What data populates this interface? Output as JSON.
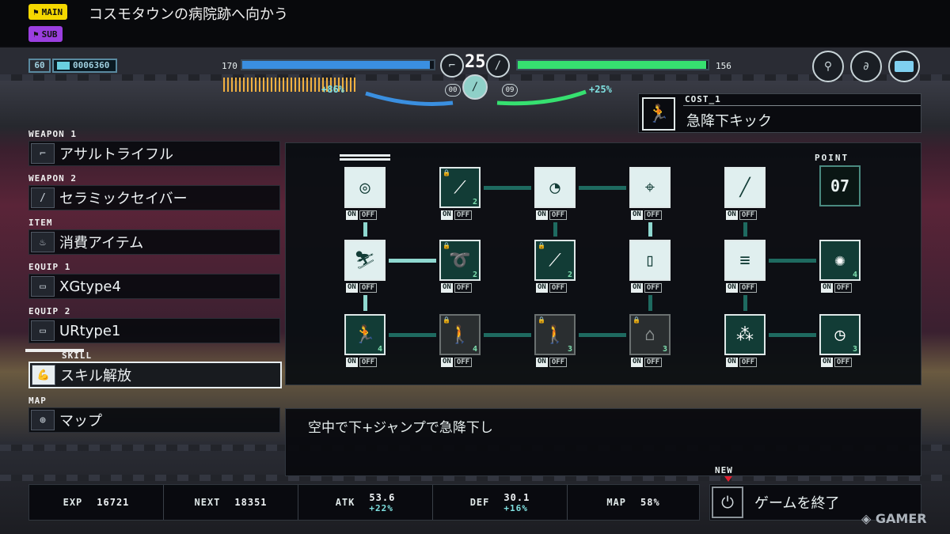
{
  "quest": {
    "main_badge": "MAIN",
    "main_text": "コスモタウンの病院跡へ向かう",
    "sub_badge": "SUB",
    "main_color": "#f5d800",
    "sub_color": "#9b3fe0"
  },
  "hud": {
    "level": "60",
    "money": "0006360",
    "hp_left": "170",
    "hp_right": "156",
    "center_value": "25",
    "left_counter": "00",
    "right_counter": "09",
    "left_bonus": "+86%",
    "right_bonus": "+25%",
    "hp_left_fraction": 0.98,
    "hp_right_fraction": 0.99,
    "colors": {
      "blue": "#3a8fe0",
      "green": "#36e070"
    }
  },
  "skill_header": {
    "cost_label": "COST_1",
    "name": "急降下キック"
  },
  "menu": {
    "weapon1": {
      "cat": "WEAPON 1",
      "label": "アサルトライフル",
      "icon": "rifle-icon"
    },
    "weapon2": {
      "cat": "WEAPON 2",
      "label": "セラミックセイバー",
      "icon": "saber-icon"
    },
    "item": {
      "cat": "ITEM",
      "label": "消費アイテム",
      "icon": "pot-icon"
    },
    "equip1": {
      "cat": "EQUIP 1",
      "label": "XGtype4",
      "icon": "chip-icon"
    },
    "equip2": {
      "cat": "EQUIP 2",
      "label": "URtype1",
      "icon": "chip-icon"
    },
    "skill": {
      "cat": "SKILL",
      "label": "スキル解放",
      "icon": "flex-arm-icon"
    },
    "map": {
      "cat": "MAP",
      "label": "マップ",
      "icon": "map-pin-icon"
    }
  },
  "skill_tree": {
    "point_label": "POINT",
    "point_value": "07",
    "on": "ON",
    "off": "OFF",
    "nodes": [
      {
        "id": "r1c1",
        "icon": "ring-icon",
        "lv": ""
      },
      {
        "id": "r1c2",
        "icon": "blade-up-icon",
        "lv": "2"
      },
      {
        "id": "r1c3",
        "icon": "slash-icon",
        "lv": ""
      },
      {
        "id": "r1c4",
        "icon": "crosshair-icon",
        "lv": ""
      },
      {
        "id": "r1c5",
        "icon": "sword-icon",
        "lv": ""
      },
      {
        "id": "r2c1",
        "icon": "slide-kick-icon",
        "lv": ""
      },
      {
        "id": "r2c2",
        "icon": "roll-icon",
        "lv": "2"
      },
      {
        "id": "r2c3",
        "icon": "blade-up-icon",
        "lv": "2"
      },
      {
        "id": "r2c4",
        "icon": "door-icon",
        "lv": ""
      },
      {
        "id": "r2c5",
        "icon": "triple-shot-icon",
        "lv": ""
      },
      {
        "id": "r2c6",
        "icon": "blast-icon",
        "lv": "4"
      },
      {
        "id": "r3c1",
        "icon": "sprint-icon",
        "lv": "4"
      },
      {
        "id": "r3c2",
        "icon": "walk-icon",
        "lv": "4"
      },
      {
        "id": "r3c3",
        "icon": "walk-icon",
        "lv": "3"
      },
      {
        "id": "r3c4",
        "icon": "crouch-icon",
        "lv": "3"
      },
      {
        "id": "r3c5",
        "icon": "drops-icon",
        "lv": ""
      },
      {
        "id": "r3c6",
        "icon": "timer-icon",
        "lv": "3"
      }
    ]
  },
  "description": "空中で下+ジャンプで急降下し",
  "stats": {
    "exp_label": "EXP",
    "exp_value": "16721",
    "next_label": "NEXT",
    "next_value": "18351",
    "atk_label": "ATK",
    "atk_value": "53.6",
    "atk_pct": "+22%",
    "def_label": "DEF",
    "def_value": "30.1",
    "def_pct": "+16%",
    "map_label": "MAP",
    "map_value": "58%"
  },
  "quit": {
    "new_label": "NEW",
    "label": "ゲームを終了"
  },
  "watermark": "GAMER"
}
